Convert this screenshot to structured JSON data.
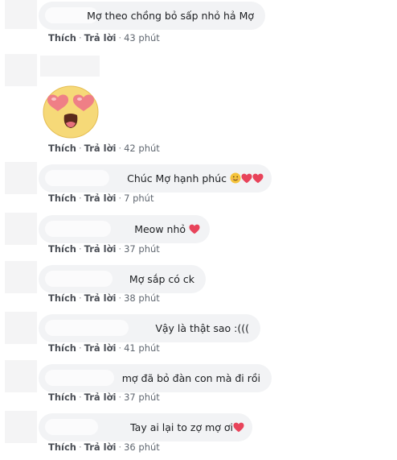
{
  "action_labels": {
    "like": "Thích",
    "reply": "Trả lời",
    "separator": "·"
  },
  "comments": [
    {
      "text": "Mợ theo chồng bỏ sấp nhỏ hả Mợ",
      "time": "43 phút"
    },
    {
      "sticker": "heart-eyes-face",
      "time": "42 phút"
    },
    {
      "text": "Chúc Mợ hạnh phúc",
      "emojis": [
        "smiling-face",
        "red-heart",
        "red-heart"
      ],
      "time": "7 phút"
    },
    {
      "text": "Meow nhỏ",
      "emojis": [
        "red-heart"
      ],
      "time": "37 phút"
    },
    {
      "text": "Mợ sắp có ck",
      "time": "38 phút"
    },
    {
      "text": "Vậy là thật sao :(((",
      "time": "41 phút"
    },
    {
      "text": "mợ đã bỏ đàn con mà đi rồi",
      "time": "37 phút"
    },
    {
      "text": "Tay ai lại to zợ mợ ơi",
      "emojis": [
        "red-heart"
      ],
      "time": "36 phút"
    }
  ],
  "colors": {
    "bubble": "#f2f3f5",
    "link": "#4b4f56",
    "meta": "#606770",
    "heart": "#e8435a"
  }
}
